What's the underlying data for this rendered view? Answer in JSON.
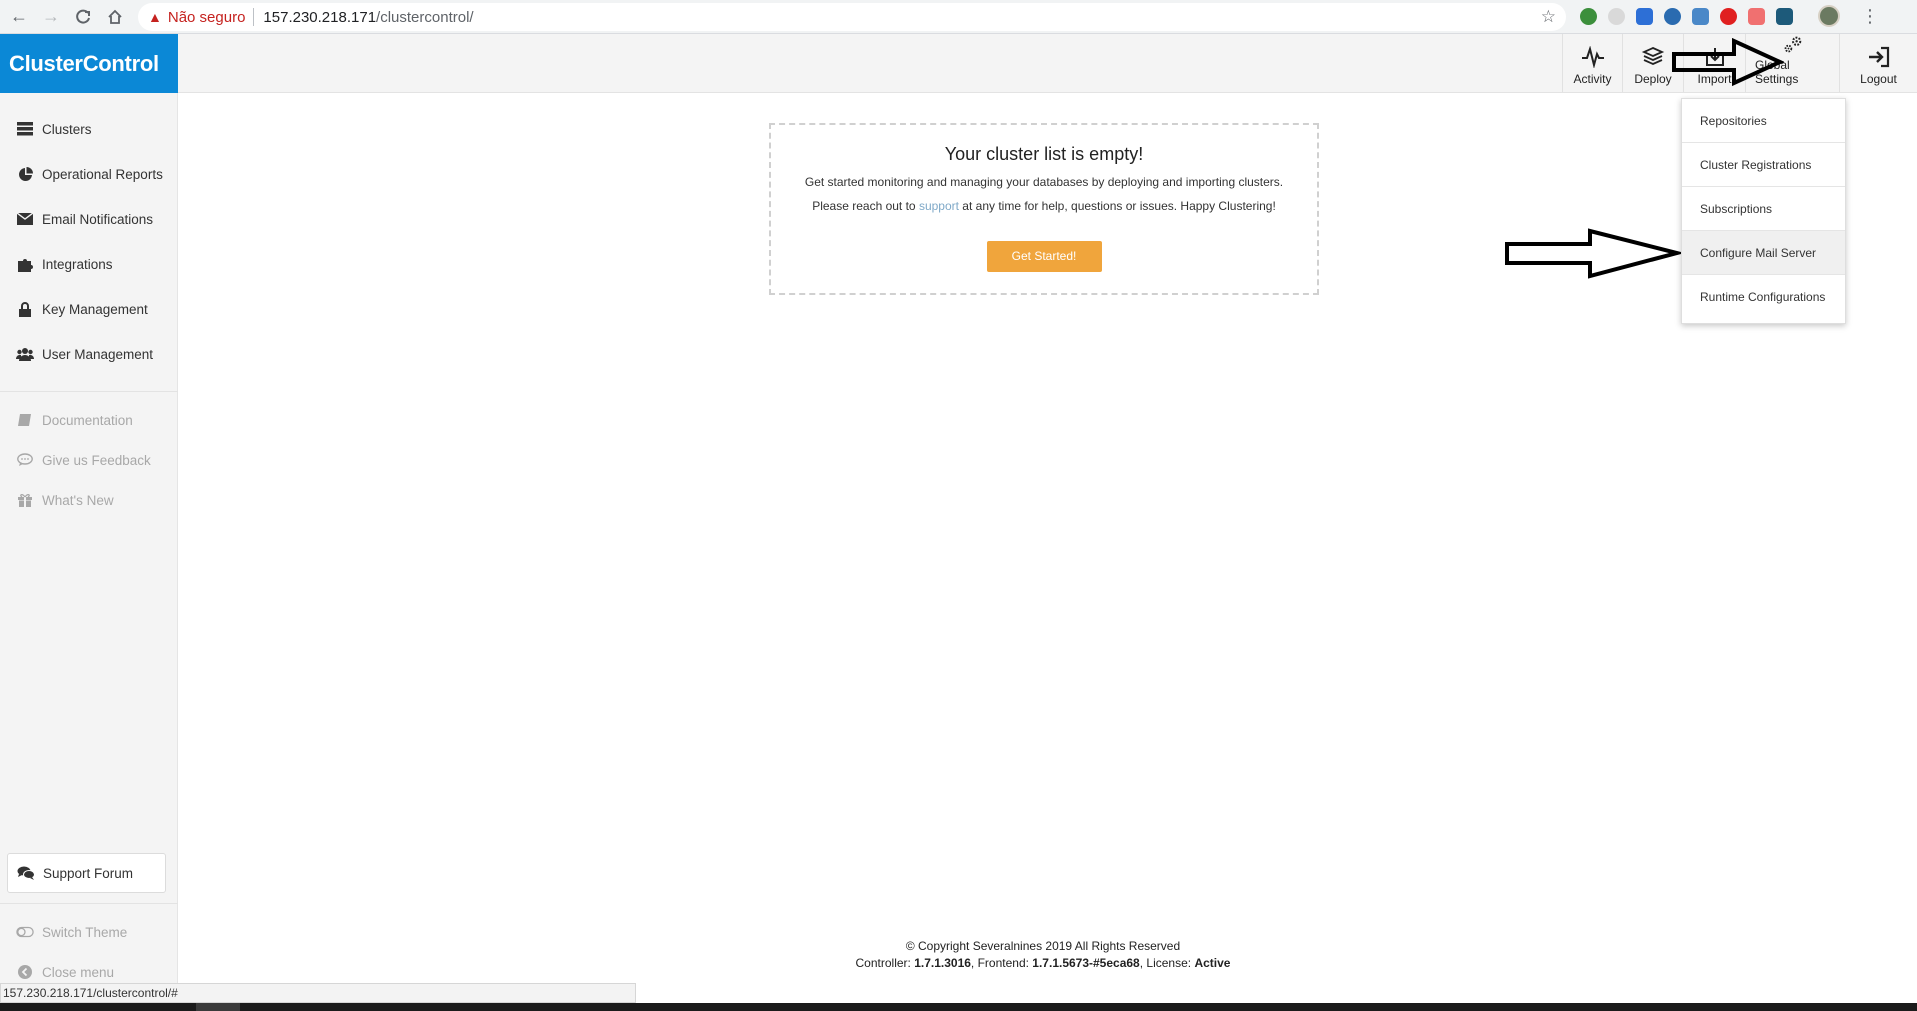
{
  "browser": {
    "security_label": "Não seguro",
    "url_host": "157.230.218.171",
    "url_path": "/clustercontrol/",
    "status_url": "157.230.218.171/clustercontrol/#"
  },
  "app": {
    "logo": "ClusterControl",
    "top_actions": {
      "activity": "Activity",
      "deploy": "Deploy",
      "import": "Import",
      "global_settings": "Global Settings",
      "logout": "Logout"
    }
  },
  "sidebar": {
    "items": [
      {
        "label": "Clusters",
        "icon": "server-icon"
      },
      {
        "label": "Operational Reports",
        "icon": "pie-chart-icon"
      },
      {
        "label": "Email Notifications",
        "icon": "envelope-icon"
      },
      {
        "label": "Integrations",
        "icon": "puzzle-icon"
      },
      {
        "label": "Key Management",
        "icon": "lock-icon"
      },
      {
        "label": "User Management",
        "icon": "users-icon"
      }
    ],
    "secondary": [
      {
        "label": "Documentation",
        "icon": "book-icon"
      },
      {
        "label": "Give us Feedback",
        "icon": "comment-icon"
      },
      {
        "label": "What's New",
        "icon": "gift-icon"
      }
    ],
    "support_forum": "Support Forum",
    "switch_theme": "Switch Theme",
    "close_menu": "Close menu"
  },
  "main": {
    "empty_title": "Your cluster list is empty!",
    "empty_line1": "Get started monitoring and managing your databases by deploying and importing clusters.",
    "empty_line2_pre": "Please reach out to ",
    "empty_line2_link": "support",
    "empty_line2_post": " at any time for help, questions or issues. Happy Clustering!",
    "get_started": "Get Started!"
  },
  "global_settings_menu": {
    "items": [
      "Repositories",
      "Cluster Registrations",
      "Subscriptions",
      "Configure Mail Server",
      "Runtime Configurations"
    ],
    "highlighted_item": "Configure Mail Server"
  },
  "footer": {
    "copyright": "© Copyright Severalnines 2019 All Rights Reserved",
    "controller_label": "Controller: ",
    "controller_version": "1.7.1.3016",
    "frontend_label": ", Frontend: ",
    "frontend_version": "1.7.1.5673-#5eca68",
    "license_label": ", License: ",
    "license_status": "Active"
  },
  "colors": {
    "brand": "#0b88d6",
    "cta": "#f0a53c",
    "link": "#7fa9c8",
    "insecure": "#c5221f"
  }
}
